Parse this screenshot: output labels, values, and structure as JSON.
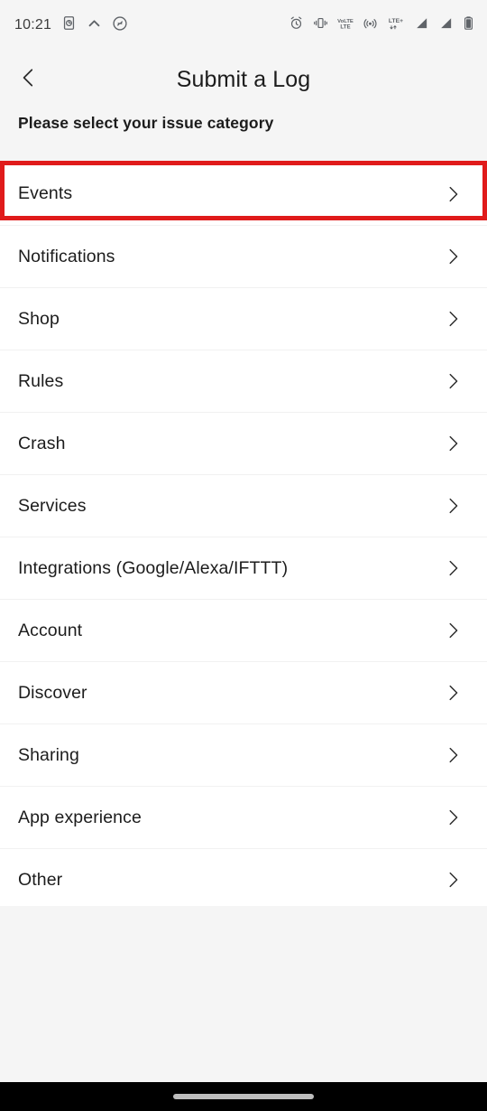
{
  "status_bar": {
    "time": "10:21",
    "left_icons": [
      "screen-record-icon",
      "chevron-up-icon",
      "shazam-icon"
    ],
    "right_icons": [
      "alarm-icon",
      "vibrate-icon",
      "volte-icon",
      "hotspot-icon",
      "lte-plus-icon",
      "signal-1-icon",
      "signal-2-icon",
      "battery-icon"
    ],
    "network_label": "LTE+",
    "volte_label_top": "VoLTE",
    "volte_label_bottom": "LTE"
  },
  "header": {
    "title": "Submit a Log",
    "back_icon": "back-chevron-icon"
  },
  "subtitle": "Please select your issue category",
  "list": {
    "items": [
      {
        "label": "Events",
        "chevron": "chevron-right-icon",
        "highlighted": true
      },
      {
        "label": "Notifications",
        "chevron": "chevron-right-icon",
        "highlighted": false
      },
      {
        "label": "Shop",
        "chevron": "chevron-right-icon",
        "highlighted": false
      },
      {
        "label": "Rules",
        "chevron": "chevron-right-icon",
        "highlighted": false
      },
      {
        "label": "Crash",
        "chevron": "chevron-right-icon",
        "highlighted": false
      },
      {
        "label": "Services",
        "chevron": "chevron-right-icon",
        "highlighted": false
      },
      {
        "label": "Integrations (Google/Alexa/IFTTT)",
        "chevron": "chevron-right-icon",
        "highlighted": false
      },
      {
        "label": "Account",
        "chevron": "chevron-right-icon",
        "highlighted": false
      },
      {
        "label": "Discover",
        "chevron": "chevron-right-icon",
        "highlighted": false
      },
      {
        "label": "Sharing",
        "chevron": "chevron-right-icon",
        "highlighted": false
      },
      {
        "label": "App experience",
        "chevron": "chevron-right-icon",
        "highlighted": false
      },
      {
        "label": "Other",
        "chevron": "chevron-right-icon",
        "highlighted": false
      }
    ]
  },
  "colors": {
    "highlight": "#e01b1b",
    "background": "#f5f5f5",
    "row_background": "#ffffff",
    "text": "#1c1c1c",
    "separator": "#f1f1f1",
    "navbar": "#000000",
    "nav_pill": "#bdbdbd"
  },
  "nav_bar": {
    "gesture_pill": "home-gesture-pill"
  }
}
